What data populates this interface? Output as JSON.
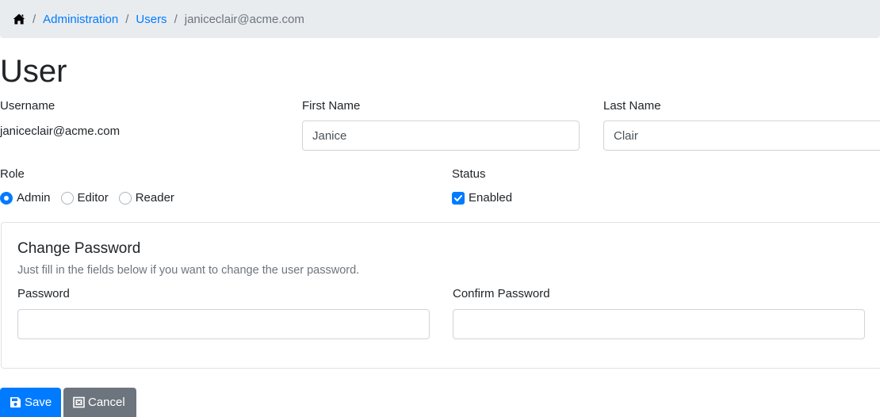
{
  "breadcrumb": {
    "home_icon": "home-icon",
    "items": [
      {
        "label": "Administration",
        "link": true
      },
      {
        "label": "Users",
        "link": true
      },
      {
        "label": "janiceclair@acme.com",
        "link": false
      }
    ],
    "separator": "/"
  },
  "page": {
    "title": "User"
  },
  "form": {
    "username": {
      "label": "Username",
      "value": "janiceclair@acme.com"
    },
    "first_name": {
      "label": "First Name",
      "value": "Janice",
      "placeholder": ""
    },
    "last_name": {
      "label": "Last Name",
      "value": "Clair",
      "placeholder": ""
    },
    "role": {
      "label": "Role",
      "options": [
        {
          "label": "Admin",
          "checked": true
        },
        {
          "label": "Editor",
          "checked": false
        },
        {
          "label": "Reader",
          "checked": false
        }
      ]
    },
    "status": {
      "label": "Status",
      "checkbox_label": "Enabled",
      "checked": true
    }
  },
  "change_password": {
    "title": "Change Password",
    "subtitle": "Just fill in the fields below if you want to change the user password.",
    "password": {
      "label": "Password",
      "value": "",
      "placeholder": ""
    },
    "confirm_password": {
      "label": "Confirm Password",
      "value": "",
      "placeholder": ""
    }
  },
  "actions": {
    "save_label": "Save",
    "save_icon": "floppy-disk-icon",
    "cancel_label": "Cancel",
    "cancel_icon": "close-square-icon"
  },
  "colors": {
    "primary": "#007bff",
    "secondary": "#6c757d",
    "breadcrumb_bg": "#e9ecef"
  }
}
